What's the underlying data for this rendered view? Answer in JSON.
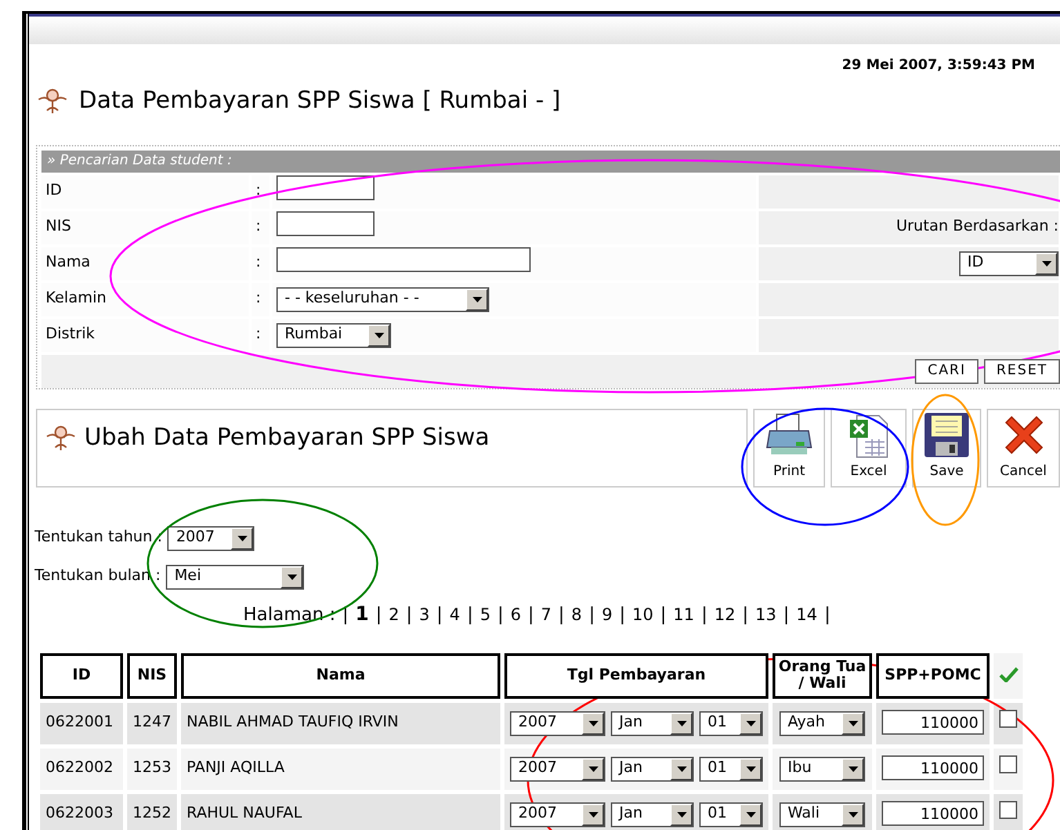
{
  "header": {
    "timestamp": "29 Mei 2007, 3:59:43 PM",
    "title": "Data Pembayaran SPP Siswa [ Rumbai - ]"
  },
  "search": {
    "heading": "» Pencarian Data student :",
    "fields": [
      {
        "label": "ID",
        "separator": ":",
        "kind": "short-text"
      },
      {
        "label": "NIS",
        "separator": ":",
        "kind": "short-text"
      },
      {
        "label": "Nama",
        "separator": ":",
        "kind": "long-text"
      },
      {
        "label": "Kelamin",
        "separator": ":",
        "kind": "select",
        "value": "- - keseluruhan - -"
      },
      {
        "label": "Distrik",
        "separator": ":",
        "kind": "select",
        "value": "Rumbai"
      }
    ],
    "sort_label": "Urutan Berdasarkan :",
    "sort_value": "ID",
    "buttons": [
      "CARI",
      "RESET"
    ]
  },
  "edit": {
    "title": "Ubah Data Pembayaran SPP Siswa",
    "actions": [
      {
        "label": "Print",
        "kind": "print"
      },
      {
        "label": "Excel",
        "kind": "excel"
      },
      {
        "label": "Save",
        "kind": "save"
      },
      {
        "label": "Cancel",
        "kind": "cancel"
      }
    ],
    "year_label": "Tentukan tahun :",
    "year": "2007",
    "month_label": "Tentukan bulan :",
    "month": "Mei"
  },
  "pagination": {
    "label": "Halaman :",
    "separator": "|",
    "pages": [
      {
        "label": "1",
        "selected": true
      },
      {
        "label": "2",
        "selected": false
      },
      {
        "label": "3",
        "selected": false
      },
      {
        "label": "4",
        "selected": false
      },
      {
        "label": "5",
        "selected": false
      },
      {
        "label": "6",
        "selected": false
      },
      {
        "label": "7",
        "selected": false
      },
      {
        "label": "8",
        "selected": false
      },
      {
        "label": "9",
        "selected": false
      },
      {
        "label": "10",
        "selected": false
      },
      {
        "label": "11",
        "selected": false
      },
      {
        "label": "12",
        "selected": false
      },
      {
        "label": "13",
        "selected": false
      },
      {
        "label": "14",
        "selected": false
      }
    ]
  },
  "table": {
    "columns": [
      "ID",
      "NIS",
      "Nama",
      "Tgl Pembayaran",
      "Orang Tua / Wali",
      "SPP+POMC"
    ],
    "rows": [
      {
        "id": "0622001",
        "nis": "1247",
        "nama": "NABIL AHMAD TAUFIQ IRVIN",
        "year": "2007",
        "month": "Jan",
        "day": "01",
        "guardian": "Ayah",
        "amount": "110000",
        "checked": false
      },
      {
        "id": "0622002",
        "nis": "1253",
        "nama": "PANJI AQILLA",
        "year": "2007",
        "month": "Jan",
        "day": "01",
        "guardian": "Ibu",
        "amount": "110000",
        "checked": false
      },
      {
        "id": "0622003",
        "nis": "1252",
        "nama": "RAHUL NAUFAL",
        "year": "2007",
        "month": "Jan",
        "day": "01",
        "guardian": "Wali",
        "amount": "110000",
        "checked": false
      }
    ]
  },
  "annotations": [
    {
      "kind": "ellipse",
      "color": "#ff00ff"
    },
    {
      "kind": "ellipse",
      "color": "#0000ff"
    },
    {
      "kind": "ellipse",
      "color": "#ff9900"
    },
    {
      "kind": "ellipse",
      "color": "#008000"
    },
    {
      "kind": "ellipse",
      "color": "#ff0000"
    }
  ]
}
